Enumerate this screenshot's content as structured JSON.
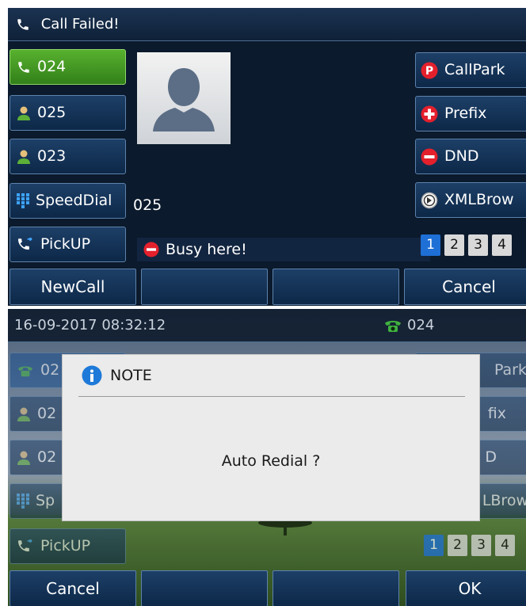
{
  "screen1": {
    "title": "Call Failed!",
    "left_keys": [
      {
        "label": "024",
        "icon": "phone-icon"
      },
      {
        "label": "025",
        "icon": "contact-icon"
      },
      {
        "label": "023",
        "icon": "contact-icon"
      },
      {
        "label": "SpeedDial",
        "icon": "keypad-icon"
      },
      {
        "label": "PickUP",
        "icon": "call-pickup-icon"
      }
    ],
    "right_keys": [
      {
        "label": "CallPark",
        "icon": "callpark-icon"
      },
      {
        "label": "Prefix",
        "icon": "prefix-icon"
      },
      {
        "label": "DND",
        "icon": "dnd-icon"
      },
      {
        "label": "XMLBrow",
        "icon": "globe-icon"
      }
    ],
    "callee_number": "025",
    "status_message": "Busy here!",
    "pages": [
      "1",
      "2",
      "3",
      "4"
    ],
    "current_page": "1",
    "softkeys": [
      "NewCall",
      "",
      "",
      "Cancel"
    ]
  },
  "screen2": {
    "datetime": "16-09-2017 08:32:12",
    "account": "024",
    "left_keys": [
      {
        "label": "02",
        "icon": "phone-icon"
      },
      {
        "label": "02",
        "icon": "contact-icon"
      },
      {
        "label": "02",
        "icon": "contact-icon"
      },
      {
        "label": "Sp",
        "icon": "keypad-icon"
      },
      {
        "label": "PickUP",
        "icon": "call-pickup-icon"
      }
    ],
    "right_keys": [
      {
        "label": "Park"
      },
      {
        "label": "fix"
      },
      {
        "label": "D"
      },
      {
        "label": "LBrow"
      }
    ],
    "dialog": {
      "title": "NOTE",
      "message": "Auto Redial ?"
    },
    "pages": [
      "1",
      "2",
      "3",
      "4"
    ],
    "current_page": "1",
    "softkeys": [
      "Cancel",
      "",
      "",
      "OK"
    ]
  },
  "colors": {
    "screen_bg": "#0b1a2c",
    "accent_green": "#4caf28",
    "page_blue": "#1e6fd6",
    "dialog_bg": "#ebebeb"
  }
}
